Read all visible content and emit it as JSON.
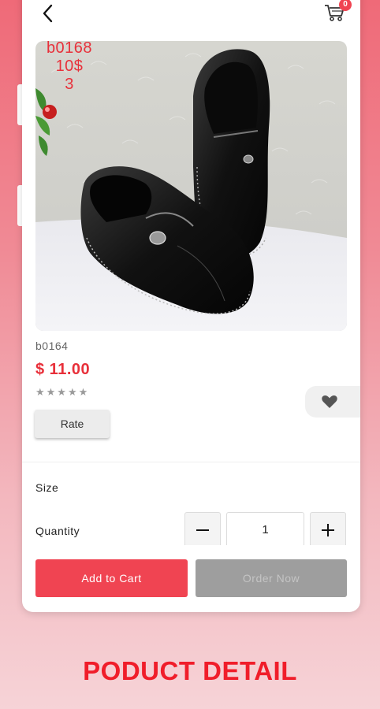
{
  "product": {
    "image_overlay": {
      "line1": "b0168",
      "line2": "10$",
      "line3": "3"
    },
    "code": "b0164",
    "price": "$ 11.00",
    "rating_stars": "★★★★★",
    "rating_value": 0,
    "rate_label": "Rate"
  },
  "header": {
    "back_icon": "chevron-left-icon",
    "cart_icon": "cart-icon",
    "cart_count": "0"
  },
  "options": {
    "size_label": "Size",
    "quantity_label": "Quantity",
    "quantity_value": "1"
  },
  "actions": {
    "add_to_cart_label": "Add to Cart",
    "order_now_label": "Order Now"
  },
  "caption": "PODUCT DETAIL",
  "colors": {
    "accent": "#f04452",
    "price": "#e8303a",
    "disabled": "#9e9e9e",
    "caption": "#f01d2a"
  }
}
